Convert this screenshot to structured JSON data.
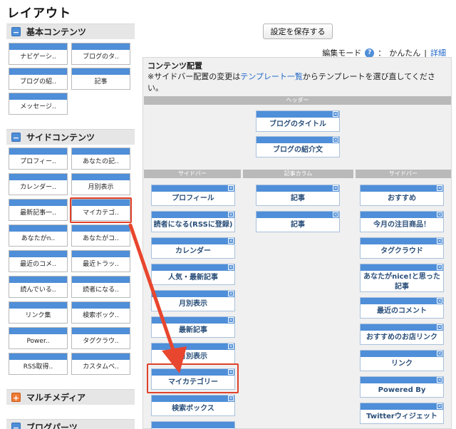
{
  "page_title": "レイアウト",
  "save_label": "設定を保存する",
  "mode": {
    "label": "編集モード",
    "help": "?",
    "sep": "：",
    "value": "かんたん",
    "bar": "|",
    "detail": "詳細"
  },
  "sections": {
    "basic": {
      "toggle": "−",
      "label": "基本コンテンツ",
      "items": [
        "ナビゲーシ..",
        "ブログのタ..",
        "ブログの紹..",
        "記事",
        "メッセージ.."
      ]
    },
    "side": {
      "toggle": "−",
      "label": "サイドコンテンツ",
      "items": [
        "プロフィー..",
        "あなたの記..",
        "カレンダー..",
        "月別表示",
        "最新記事一..",
        "マイカテゴ..",
        "あなたがn..",
        "あなたがコ..",
        "最近のコメ..",
        "最近トラッ..",
        "読んでいる..",
        "読者になる..",
        "リンク集",
        "検索ボック..",
        "Power..",
        "タグクラウ..",
        "RSS取得..",
        "カスタムベ.."
      ]
    },
    "multi": {
      "toggle": "+",
      "label": "マルチメディア"
    },
    "parts": {
      "toggle": "−",
      "label": "ブログパーツ"
    }
  },
  "panel": {
    "title": "コンテンツ配置",
    "desc_pre": "※サイドバー配置の変更は",
    "desc_link": "テンプレート一覧",
    "desc_post": "からテンプレートを選び直してください。",
    "header_label": "ヘッダー",
    "header_blocks": [
      "ブログのタイトル",
      "ブログの紹介文"
    ],
    "col_left_label": "サイドバー",
    "col_mid_label": "記事カラム",
    "col_right_label": "サイドバー",
    "close_glyph": "×",
    "left_blocks": [
      "プロフィール",
      "読者になる(RSSに登録)",
      "カレンダー",
      "人気・最新記事",
      "月別表示",
      "最新記事",
      "月別表示",
      "マイカテゴリー",
      "検索ボックス"
    ],
    "mid_blocks": [
      "記事",
      "記事"
    ],
    "right_blocks": [
      "おすすめ",
      "今月の注目商品！",
      "タグクラウド",
      "あなたがnice!と思った記事",
      "最近のコメント",
      "おすすめのお店リンク",
      "リンク",
      "Powered By",
      "Twitterウィジェット"
    ]
  },
  "colors": {
    "accent": "#4f8ed8",
    "highlight": "#e0412a",
    "link": "#1f66c8"
  }
}
